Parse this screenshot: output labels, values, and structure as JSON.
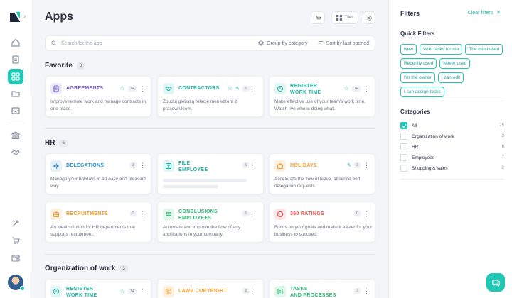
{
  "page": {
    "title": "Apps"
  },
  "header": {
    "tiles_label": "Tiles"
  },
  "search": {
    "placeholder": "Search for the app",
    "group_label": "Group by category",
    "sort_label": "Sort by last opened"
  },
  "sections": [
    {
      "title": "Favorite",
      "count": "3",
      "apps": [
        {
          "name_line1": "AGREEMENTS",
          "name_line2": "",
          "badge": "14",
          "starred": true,
          "pinned": false,
          "desc": "Improve remote work and manage contracts in one place.",
          "color": "#6a5ad6",
          "icon": "document-icon"
        },
        {
          "name_line1": "CONTRACTORS",
          "name_line2": "",
          "badge": "5",
          "starred": true,
          "pinned": true,
          "desc": "Zbuduj głębszą relację menedżera z pracownikiem.",
          "color": "#1fb3a3",
          "icon": "handshake-icon"
        },
        {
          "name_line1": "REGISTER",
          "name_line2": "WORK TIME",
          "badge": "14",
          "starred": true,
          "pinned": false,
          "desc": "Make effective use of your team's work time. Watch live who is doing what.",
          "color": "#1fb3a3",
          "icon": "clock-icon"
        }
      ]
    },
    {
      "title": "HR",
      "count": "6",
      "apps": [
        {
          "name_line1": "DELEGATIONS",
          "name_line2": "",
          "badge": "3",
          "desc": "Manage your holidays in an easy and pleasant way.",
          "color": "#2e8fd6",
          "icon": "plane-icon"
        },
        {
          "name_line1": "FILE",
          "name_line2": "EMPLOYEE",
          "badge": "5",
          "desc": "",
          "color": "#1fb3a3",
          "icon": "id-card-icon"
        },
        {
          "name_line1": "HOLIDAYS",
          "name_line2": "",
          "badge": "3",
          "pinned": true,
          "desc": "Accelerate the flow of leave, absence and delegation requests.",
          "color": "#f39a2a",
          "icon": "suitcase-icon"
        },
        {
          "name_line1": "RECRUITMENTS",
          "name_line2": "",
          "badge": "3",
          "desc": "An ideal solution for HR departments that supports recruitment.",
          "color": "#f39a2a",
          "icon": "briefcase-icon"
        },
        {
          "name_line1": "CONCLUSIONS",
          "name_line2": "EMPLOYEES",
          "badge": "5",
          "desc": "Automate and improve the flow of any applications in your company.",
          "color": "#2bb673",
          "icon": "people-icon"
        },
        {
          "name_line1": "360 RATINGS",
          "name_line2": "",
          "badge": "0",
          "desc": "Focus on your goals and make it easier for your business to succeed.",
          "color": "#ec4a4a",
          "icon": "target-icon"
        }
      ]
    },
    {
      "title": "Organization of work",
      "count": "3",
      "apps": [
        {
          "name_line1": "REGISTER",
          "name_line2": "WORK TIME",
          "badge": "14",
          "starred": true,
          "desc": "",
          "color": "#1fb3a3",
          "icon": "clock-icon"
        },
        {
          "name_line1": "LAWS COPYRIGHT",
          "name_line2": "",
          "badge": "3",
          "desc": "",
          "color": "#f39a2a",
          "icon": "copyright-icon"
        },
        {
          "name_line1": "TASKS",
          "name_line2": "AND PROCESSES",
          "badge": "3",
          "desc": "",
          "color": "#2bb673",
          "icon": "tasks-icon"
        }
      ]
    }
  ],
  "filters": {
    "title": "Filters",
    "clear_label": "Clear filters",
    "quick_title": "Quick Filters",
    "quick": [
      "New",
      "With tasks for me",
      "The most used",
      "Recently used",
      "Never used",
      "I'm the owner",
      "I can edit",
      "I can assign tasks"
    ],
    "categories_title": "Categories",
    "categories": [
      {
        "label": "All",
        "count": "75",
        "checked": true
      },
      {
        "label": "Organization of work",
        "count": "3",
        "checked": false
      },
      {
        "label": "HR",
        "count": "6",
        "checked": false
      },
      {
        "label": "Employees",
        "count": "7",
        "checked": false
      },
      {
        "label": "Shopping & sales",
        "count": "2",
        "checked": false
      }
    ]
  },
  "colors": {
    "accent": "#1fc8b5",
    "background": "#f4f5f9"
  }
}
